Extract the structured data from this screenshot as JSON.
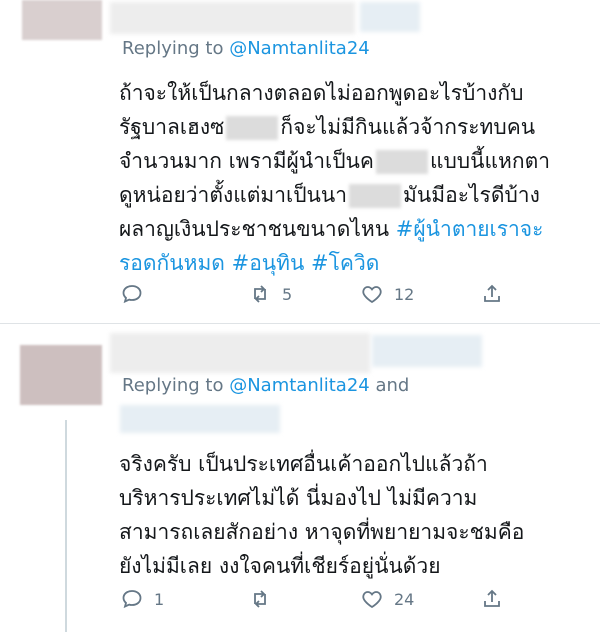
{
  "tweets": [
    {
      "replying_to": "Replying to",
      "handle": "@Namtanlita24",
      "handle_suffix": "",
      "lines": [
        {
          "parts": [
            {
              "text": "ถ้าจะให้เป็นกลางตลอดไม่ออกพูดอะไรบ้างกับ"
            }
          ]
        },
        {
          "parts": [
            {
              "text": "รัฐบาลเฮงซ"
            },
            {
              "text": "ก็จะไม่มีกินแล้วจ้ากระทบคน"
            }
          ]
        },
        {
          "parts": [
            {
              "text": "จำนวนมาก เพรามีผู้นำเป็นค"
            },
            {
              "text": "แบบนี้แหกตา"
            }
          ]
        },
        {
          "parts": [
            {
              "text": "ดูหน่อยว่าตั้งแต่มาเป็นนา"
            },
            {
              "text": "มันมีอะไรดีบ้าง"
            }
          ]
        },
        {
          "parts": [
            {
              "text": "ผลาญเงินประชาชนขนาดไหน "
            },
            {
              "text": "#ผู้นำตายเราจะ",
              "tag": true
            }
          ]
        },
        {
          "parts": [
            {
              "text": "รอดกันหมด #อนุทิน #โควิด",
              "tag": true
            }
          ]
        }
      ],
      "actions": {
        "reply": "",
        "retweet": "5",
        "like": "12"
      }
    },
    {
      "replying_to": "Replying to",
      "handle": "@Namtanlita24",
      "handle_suffix": " and",
      "lines": [
        {
          "parts": [
            {
              "text": "จริงครับ เป็นประเทศอื่นเค้าออกไปแล้วถ้า"
            }
          ]
        },
        {
          "parts": [
            {
              "text": "บริหารประเทศไม่ได้ นี่มองไป ไม่มีความ"
            }
          ]
        },
        {
          "parts": [
            {
              "text": "สามารถเลยสักอย่าง หาจุดที่พยายามจะชมคือ"
            }
          ]
        },
        {
          "parts": [
            {
              "text": "ยังไม่มีเลย งงใจคนที่เชียร์อยู่นั่นด้วย"
            }
          ]
        }
      ],
      "actions": {
        "reply": "1",
        "retweet": "",
        "like": "24"
      }
    }
  ],
  "colors": {
    "link": "#1b95e0",
    "muted": "#657786",
    "text": "#14171a"
  },
  "icons": [
    "reply-icon",
    "retweet-icon",
    "like-icon",
    "share-icon"
  ]
}
